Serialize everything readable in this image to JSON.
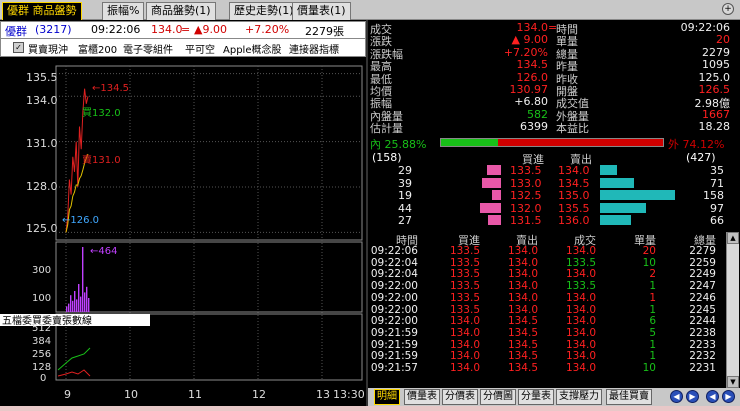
{
  "tabs": [
    {
      "label": "優群 商品盤勢",
      "active": true
    },
    {
      "label": "振幅%",
      "active": false
    },
    {
      "label": "商品盤勢(1)",
      "active": false
    },
    {
      "label": "歷史走勢(1)",
      "active": false
    },
    {
      "label": "價量表(1)",
      "active": false
    }
  ],
  "info": {
    "name": "優群",
    "code": "(3217)",
    "time": "09:22:06",
    "price": "134.0",
    "price_flag": "=",
    "change": "▲9.00",
    "change_pct": "+7.20%",
    "volume": "2279張"
  },
  "chips": [
    "買賣現沖",
    "富櫃200",
    "電子零組件",
    "平可空",
    "Apple概念股",
    "連接器指標"
  ],
  "chart": {
    "price_axis": [
      "135.5",
      "134.0",
      "131.0",
      "128.0",
      "125.0"
    ],
    "annotations": {
      "high": "134.5",
      "mid_green": "132.0",
      "mid_red": "131.0",
      "low": "126.0",
      "vol_peak": "464"
    },
    "volume_axis": [
      "300",
      "100"
    ],
    "indicator_label": "五檔委買委賣張數線",
    "indicator_axis": [
      "512",
      "384",
      "256",
      "128",
      "0"
    ],
    "time_axis": [
      "9",
      "10",
      "11",
      "12",
      "13",
      "13:30"
    ],
    "buy_flag": "買",
    "sell_flag": "賣"
  },
  "chart_data": {
    "type": "line",
    "title": "",
    "xlabel": "",
    "ylabel": "",
    "x_ticks": [
      "9",
      "10",
      "11",
      "12",
      "13",
      "13:30"
    ],
    "ylim": [
      124.5,
      136
    ],
    "series": [
      {
        "values": [
          125.0,
          126.0,
          128.5,
          127.5,
          130.0,
          129.0,
          131.0,
          128.0,
          132.0,
          130.5,
          133.0,
          134.5,
          133.5,
          134.0
        ]
      }
    ],
    "volume_ylim": [
      0,
      500
    ],
    "volume_values": [
      40,
      60,
      120,
      80,
      150,
      90,
      200,
      110,
      464,
      140,
      180,
      100
    ],
    "volume_ticks": [
      300,
      100
    ],
    "indicator_ylim": [
      0,
      512
    ],
    "indicator_ticks": [
      512,
      384,
      256,
      128,
      0
    ]
  },
  "quote": {
    "rows": [
      {
        "l1": "成交",
        "v1": "134.0",
        "v1_suffix": "=",
        "c1": "red",
        "l2": "時間",
        "v2": "09:22:06",
        "c2": "white"
      },
      {
        "l1": "漲跌",
        "v1": "▲ 9.00",
        "c1": "red",
        "l2": "單量",
        "v2": "20",
        "c2": "red"
      },
      {
        "l1": "漲跌幅",
        "v1": "+7.20%",
        "c1": "red",
        "l2": "總量",
        "v2": "2279",
        "c2": "white"
      },
      {
        "l1": "最高",
        "v1": "134.5",
        "c1": "red",
        "l2": "昨量",
        "v2": "1095",
        "c2": "white"
      },
      {
        "l1": "最低",
        "v1": "126.0",
        "c1": "red",
        "l2": "昨收",
        "v2": "125.0",
        "c2": "white"
      },
      {
        "l1": "均價",
        "v1": "130.97",
        "c1": "red",
        "l2": "開盤",
        "v2": "126.5",
        "c2": "red"
      },
      {
        "l1": "振幅",
        "v1": "+6.80",
        "c1": "white",
        "l2": "成交值",
        "v2": "2.98億",
        "c2": "white"
      },
      {
        "l1": "內盤量",
        "v1": "582",
        "c1": "green",
        "l2": "外盤量",
        "v2": "1667",
        "c2": "red"
      },
      {
        "l1": "估計量",
        "v1": "6399",
        "c1": "white",
        "l2": "本益比",
        "v2": "18.28",
        "c2": "white"
      }
    ],
    "inner_label": "內 25.88%",
    "outer_label": "外 74.12%",
    "inner_pct": 25.88,
    "bid_total": "(158)",
    "ask_total": "(427)",
    "bid_header": "買進",
    "ask_header": "賣出"
  },
  "order_book": [
    {
      "bid_vol": "29",
      "bid": "133.5",
      "ask": "134.0",
      "ask_vol": "35",
      "bid_n": 29,
      "ask_n": 35
    },
    {
      "bid_vol": "39",
      "bid": "133.0",
      "ask": "134.5",
      "ask_vol": "71",
      "bid_n": 39,
      "ask_n": 71
    },
    {
      "bid_vol": "19",
      "bid": "132.5",
      "ask": "135.0",
      "ask_vol": "158",
      "bid_n": 19,
      "ask_n": 158
    },
    {
      "bid_vol": "44",
      "bid": "132.0",
      "ask": "135.5",
      "ask_vol": "97",
      "bid_n": 44,
      "ask_n": 97
    },
    {
      "bid_vol": "27",
      "bid": "131.5",
      "ask": "136.0",
      "ask_vol": "66",
      "bid_n": 27,
      "ask_n": 66
    }
  ],
  "ticks": {
    "headers": [
      "時間",
      "買進",
      "賣出",
      "成交",
      "單量",
      "總量"
    ],
    "rows": [
      {
        "t": "09:22:06",
        "b": "133.5",
        "s": "134.0",
        "p": "134.0",
        "q": "20",
        "tot": "2279",
        "pc": "red",
        "qc": "red"
      },
      {
        "t": "09:22:04",
        "b": "133.5",
        "s": "134.0",
        "p": "133.5",
        "q": "10",
        "tot": "2259",
        "pc": "green",
        "qc": "green"
      },
      {
        "t": "09:22:04",
        "b": "133.5",
        "s": "134.0",
        "p": "134.0",
        "q": "2",
        "tot": "2249",
        "pc": "red",
        "qc": "red"
      },
      {
        "t": "09:22:00",
        "b": "133.5",
        "s": "134.0",
        "p": "133.5",
        "q": "1",
        "tot": "2247",
        "pc": "green",
        "qc": "green"
      },
      {
        "t": "09:22:00",
        "b": "133.5",
        "s": "134.0",
        "p": "134.0",
        "q": "1",
        "tot": "2246",
        "pc": "red",
        "qc": "red"
      },
      {
        "t": "09:22:00",
        "b": "133.5",
        "s": "134.0",
        "p": "134.0",
        "q": "1",
        "tot": "2245",
        "pc": "red",
        "qc": "green"
      },
      {
        "t": "09:22:00",
        "b": "134.0",
        "s": "134.5",
        "p": "134.0",
        "q": "6",
        "tot": "2244",
        "pc": "red",
        "qc": "green"
      },
      {
        "t": "09:21:59",
        "b": "134.0",
        "s": "134.5",
        "p": "134.0",
        "q": "5",
        "tot": "2238",
        "pc": "red",
        "qc": "green"
      },
      {
        "t": "09:21:59",
        "b": "134.0",
        "s": "134.5",
        "p": "134.0",
        "q": "1",
        "tot": "2233",
        "pc": "red",
        "qc": "green"
      },
      {
        "t": "09:21:59",
        "b": "134.0",
        "s": "134.5",
        "p": "134.0",
        "q": "1",
        "tot": "2232",
        "pc": "red",
        "qc": "green"
      },
      {
        "t": "09:21:57",
        "b": "134.0",
        "s": "134.5",
        "p": "134.0",
        "q": "10",
        "tot": "2231",
        "pc": "red",
        "qc": "green"
      }
    ]
  },
  "bottom_tabs": [
    {
      "label": "明細",
      "active": true
    },
    {
      "label": "價量表",
      "active": false
    },
    {
      "label": "分價表",
      "active": false
    },
    {
      "label": "分價圖",
      "active": false
    },
    {
      "label": "分量表",
      "active": false
    },
    {
      "label": "支撐壓力",
      "active": false
    },
    {
      "label": "最佳買賣",
      "active": false
    }
  ],
  "icons": {
    "nav": [
      "prev-icon",
      "next-icon",
      "left-arrow-icon",
      "right-arrow-icon"
    ],
    "zoom": "zoom-icon"
  },
  "colors": {
    "up": "#d00000",
    "down": "#18c018",
    "accent": "#ffd800",
    "bid_bar": "#e858a8",
    "ask_bar": "#20b8b8"
  }
}
